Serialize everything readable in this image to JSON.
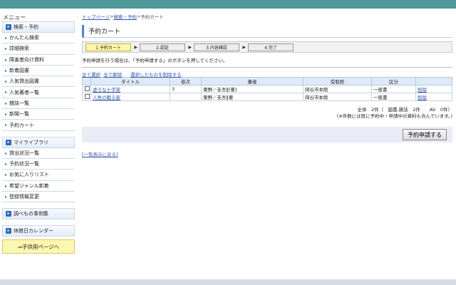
{
  "sidebar": {
    "menu_title": "メニュー",
    "search_section": "検索・予約",
    "search_items": [
      "かんたん検索",
      "詳細検索",
      "障害者向け資料",
      "新着図書",
      "人気貸出図書",
      "人気著者一覧",
      "雑誌一覧",
      "新聞一覧",
      "予約カート"
    ],
    "mylib_section": "マイライブラリ",
    "mylib_items": [
      "貸出状況一覧",
      "予約状況一覧",
      "お気に入りリスト",
      "希望ジャンル新着",
      "登録情報変更"
    ],
    "research_section": "調べもの事例集",
    "calendar_section": "休館日カレンダー",
    "kids_link": "⇒子供用ページへ"
  },
  "breadcrumb": {
    "home": "トップページ",
    "sep1": " > ",
    "search": "検索・予約",
    "sep2": " > ",
    "current": "予約カート"
  },
  "page_title": "予約カート",
  "steps": [
    "1.予約カート",
    "2.認証",
    "3.内容確認",
    "4.完了"
  ],
  "notice": "予約申請を行う場合は、「予約申請する」のボタンを押してください。",
  "links": {
    "select_all": "全て選択",
    "clear_all": "全て解除",
    "delete_selected": "選択したものを削除する"
  },
  "table": {
    "headers": [
      "タイトル",
      "巻次",
      "著者",
      "受取館",
      "区分"
    ],
    "rows": [
      {
        "title": "虚ろな十字架",
        "volume": "3",
        "author": "東野／圭吾‖[著]",
        "branch": "岡谷市本館",
        "category": "一般書",
        "action": "削除"
      },
      {
        "title": "人魚の眠る家",
        "volume": "",
        "author": "東野／圭吾‖著",
        "branch": "岡谷市本館",
        "category": "一般書",
        "action": "削除"
      }
    ]
  },
  "summary": {
    "line1": "全体　2件（　図書,雑誌　2件　　AV　0件）",
    "line2": "(※件数には既に予約中・申請中の資料も含んでいます。)"
  },
  "reserve_button": "予約申請する",
  "back_link": "[一覧表示に戻る]"
}
